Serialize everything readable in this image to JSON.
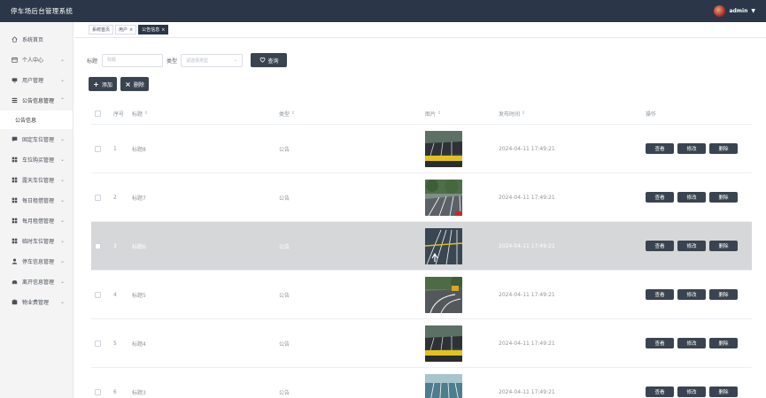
{
  "header": {
    "title": "停车场后台管理系统",
    "user": "admin"
  },
  "sidebar": {
    "items": [
      {
        "label": "系统首页",
        "icon": "home-icon",
        "expandable": false
      },
      {
        "label": "个人中心",
        "icon": "calendar-icon",
        "expandable": true
      },
      {
        "label": "用户管理",
        "icon": "monitor-icon",
        "expandable": true
      },
      {
        "label": "公告信息管理",
        "icon": "list-icon",
        "expandable": true,
        "open": true,
        "children": [
          "公告信息"
        ]
      },
      {
        "label": "固定车位管理",
        "icon": "message-icon",
        "expandable": true
      },
      {
        "label": "车位购买管理",
        "icon": "grid-icon",
        "expandable": true
      },
      {
        "label": "露天车位管理",
        "icon": "grid-icon",
        "expandable": true
      },
      {
        "label": "每日租借管理",
        "icon": "grid-icon",
        "expandable": true
      },
      {
        "label": "每月租借管理",
        "icon": "grid-icon",
        "expandable": true
      },
      {
        "label": "临时车位管理",
        "icon": "grid-icon",
        "expandable": true
      },
      {
        "label": "停车信息管理",
        "icon": "user-icon",
        "expandable": true
      },
      {
        "label": "离开信息管理",
        "icon": "car-icon",
        "expandable": true
      },
      {
        "label": "物业费管理",
        "icon": "wallet-icon",
        "expandable": true
      }
    ]
  },
  "tabs": [
    {
      "label": "系统首页",
      "closable": false,
      "active": false
    },
    {
      "label": "用户",
      "closable": true,
      "active": false
    },
    {
      "label": "公告信息",
      "closable": true,
      "active": true
    }
  ],
  "search": {
    "title_label": "标题",
    "title_placeholder": "标题",
    "type_label": "类型",
    "type_placeholder": "请选择类型",
    "query_label": "查询"
  },
  "actions": {
    "add_label": "添加",
    "delete_label": "删除"
  },
  "table": {
    "columns": {
      "index": "序号",
      "title": "标题",
      "type": "类型",
      "image": "图片",
      "time": "发布时间",
      "ops": "操作"
    },
    "ops": {
      "view": "查看",
      "edit": "修改",
      "delete": "删除"
    },
    "rows": [
      {
        "index": "1",
        "title": "标题8",
        "type": "公告",
        "time": "2024-04-11 17:49:21",
        "image": "parking-lot-photo"
      },
      {
        "index": "2",
        "title": "标题7",
        "type": "公告",
        "time": "2024-04-11 17:49:21",
        "image": "parking-lot-photo"
      },
      {
        "index": "3",
        "title": "标题6",
        "type": "公告",
        "time": "2024-04-11 17:49:21",
        "image": "parking-lot-photo"
      },
      {
        "index": "4",
        "title": "标题5",
        "type": "公告",
        "time": "2024-04-11 17:49:21",
        "image": "parking-lot-photo"
      },
      {
        "index": "5",
        "title": "标题4",
        "type": "公告",
        "time": "2024-04-11 17:49:21",
        "image": "parking-lot-photo"
      },
      {
        "index": "6",
        "title": "标题3",
        "type": "公告",
        "time": "2024-04-11 17:49:21",
        "image": "parking-lot-photo"
      }
    ]
  },
  "colors": {
    "topbar": "#2b3748",
    "button": "#3a4450",
    "highlight_row": "#d6d7d9"
  }
}
